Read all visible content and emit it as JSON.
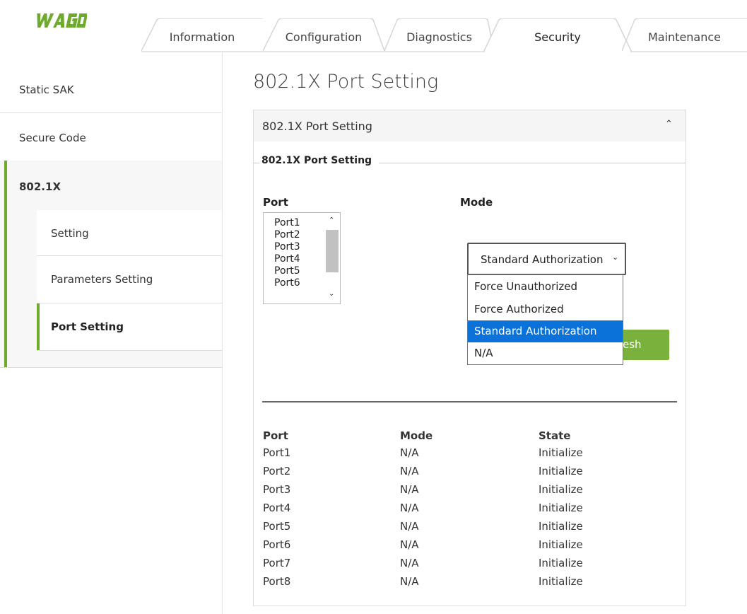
{
  "brand": {
    "logo_text": "WAGO",
    "accent": "#6eaa2e"
  },
  "tabs": [
    {
      "label": "Information",
      "active": false
    },
    {
      "label": "Configuration",
      "active": false
    },
    {
      "label": "Diagnostics",
      "active": false
    },
    {
      "label": "Security",
      "active": true
    },
    {
      "label": "Maintenance",
      "active": false
    }
  ],
  "sidebar": {
    "items": [
      {
        "label": "Static SAK"
      },
      {
        "label": "Secure Code"
      },
      {
        "label": "802.1X"
      },
      {
        "label": "Setting"
      },
      {
        "label": "Parameters Setting"
      },
      {
        "label": "Port Setting"
      }
    ]
  },
  "main": {
    "page_title": "802.1X Port Setting",
    "panel_title": "802.1X Port Setting",
    "fieldset_legend": "802.1X Port Setting",
    "port_label": "Port",
    "mode_label": "Mode",
    "port_options": [
      "Port1",
      "Port2",
      "Port3",
      "Port4",
      "Port5",
      "Port6"
    ],
    "mode_selected": "Standard Authorization",
    "mode_options": [
      "Force Unauthorized",
      "Force Authorized",
      "Standard Authorization",
      "N/A"
    ],
    "refresh_label_visible": "esh"
  },
  "table": {
    "headers": [
      "Port",
      "Mode",
      "State"
    ],
    "rows": [
      [
        "Port1",
        "N/A",
        "Initialize"
      ],
      [
        "Port2",
        "N/A",
        "Initialize"
      ],
      [
        "Port3",
        "N/A",
        "Initialize"
      ],
      [
        "Port4",
        "N/A",
        "Initialize"
      ],
      [
        "Port5",
        "N/A",
        "Initialize"
      ],
      [
        "Port6",
        "N/A",
        "Initialize"
      ],
      [
        "Port7",
        "N/A",
        "Initialize"
      ],
      [
        "Port8",
        "N/A",
        "Initialize"
      ]
    ]
  }
}
